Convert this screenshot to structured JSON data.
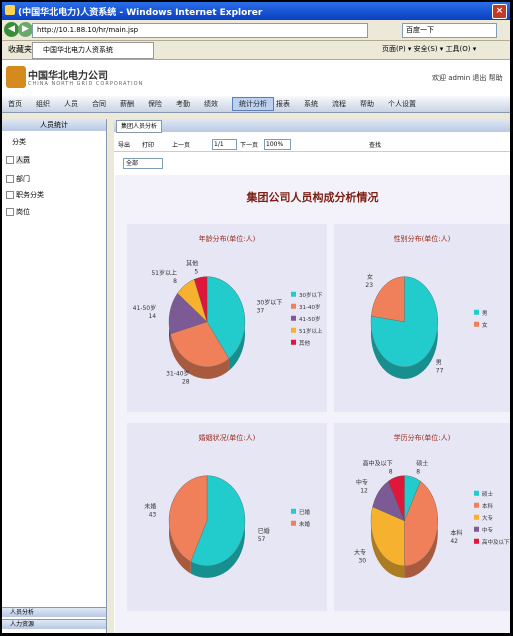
{
  "window": {
    "title": "(中国华北电力)人资系统 - Windows Internet Explorer"
  },
  "address": {
    "url": "http://10.1.88.10/hr/main.jsp",
    "search": "百度一下"
  },
  "favbar": {
    "favorites": "收藏夹",
    "tab": "中国华北电力人资系统",
    "tools": "页面(P) ▾  安全(S) ▾  工具(O) ▾"
  },
  "header": {
    "company": "中国华北电力公司",
    "company_en": "CHINA NORTH GRID CORPORATION",
    "user": "欢迎 admin  退出  帮助"
  },
  "menu": [
    "首页",
    "组织",
    "人员",
    "合同",
    "薪酬",
    "保险",
    "考勤",
    "绩效",
    "统计分析",
    "报表",
    "系统",
    "流程",
    "帮助",
    "个人设置"
  ],
  "menu_active_index": 8,
  "left": {
    "title": "人员统计",
    "sub": "分类",
    "items": [
      "人员",
      "部门",
      "职务分类",
      "岗位"
    ],
    "footer1": "人员分析",
    "footer2": "人力资源"
  },
  "main": {
    "tab": "集团人员分析"
  },
  "toolbar": {
    "export": "导出",
    "print": "打印",
    "page": "1/1",
    "zoom": "100%",
    "find": "查找",
    "prev": "上一页",
    "next": "下一页"
  },
  "toolbar2": {
    "select": "全部"
  },
  "report": {
    "title": "集团公司人员构成分析情况"
  },
  "charts": [
    {
      "title": "年龄分布(单位:人)",
      "type": "pie",
      "slices": [
        {
          "label": "30岁以下",
          "value": 37,
          "color": "#22cccc"
        },
        {
          "label": "31-40岁",
          "value": 28,
          "color": "#f0805a"
        },
        {
          "label": "41-50岁",
          "value": 14,
          "color": "#7b5a95"
        },
        {
          "label": "51岁以上",
          "value": 8,
          "color": "#f6b12f"
        },
        {
          "label": "其他",
          "value": 5,
          "color": "#e0163a"
        }
      ]
    },
    {
      "title": "性别分布(单位:人)",
      "type": "pie",
      "slices": [
        {
          "label": "男",
          "value": 77,
          "color": "#22cccc"
        },
        {
          "label": "女",
          "value": 23,
          "color": "#f0805a"
        }
      ]
    },
    {
      "title": "婚姻状况(单位:人)",
      "type": "pie",
      "slices": [
        {
          "label": "已婚",
          "value": 57,
          "color": "#22cccc"
        },
        {
          "label": "未婚",
          "value": 43,
          "color": "#f0805a"
        }
      ]
    },
    {
      "title": "学历分布(单位:人)",
      "type": "pie",
      "slices": [
        {
          "label": "硕士",
          "value": 8,
          "color": "#22cccc"
        },
        {
          "label": "本科",
          "value": 42,
          "color": "#f0805a"
        },
        {
          "label": "大专",
          "value": 30,
          "color": "#f6b12f"
        },
        {
          "label": "中专",
          "value": 12,
          "color": "#7b5a95"
        },
        {
          "label": "高中及以下",
          "value": 8,
          "color": "#e0163a"
        }
      ]
    }
  ]
}
